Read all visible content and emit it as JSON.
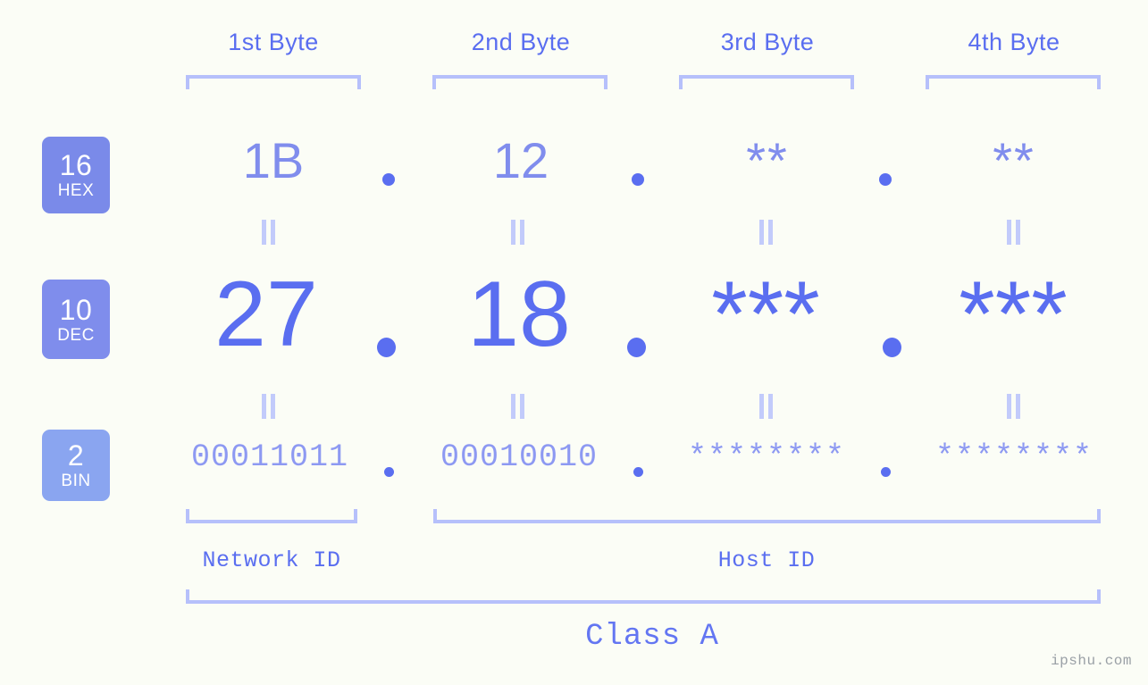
{
  "background_color": "#fbfdf6",
  "accent_color": "#5a6ef0",
  "accent_light_color": "#b6c0fb",
  "byte_headers": [
    {
      "label": "1st Byte"
    },
    {
      "label": "2nd Byte"
    },
    {
      "label": "3rd Byte"
    },
    {
      "label": "4th Byte"
    }
  ],
  "radix_rows": [
    {
      "badge_number": "16",
      "badge_name": "HEX",
      "badge_color": "#7a8ae9",
      "values": [
        "1B",
        "12",
        "**",
        "**"
      ],
      "separator": "."
    },
    {
      "badge_number": "10",
      "badge_name": "DEC",
      "badge_color": "#7f8dec",
      "values": [
        "27",
        "18",
        "***",
        "***"
      ],
      "separator": "."
    },
    {
      "badge_number": "2",
      "badge_name": "BIN",
      "badge_color": "#8aa5f0",
      "values": [
        "00011011",
        "00010010",
        "********",
        "********"
      ],
      "separator": "."
    }
  ],
  "id_sections": [
    {
      "label": "Network ID"
    },
    {
      "label": "Host ID"
    }
  ],
  "class_label": "Class A",
  "watermark": "ipshu.com"
}
